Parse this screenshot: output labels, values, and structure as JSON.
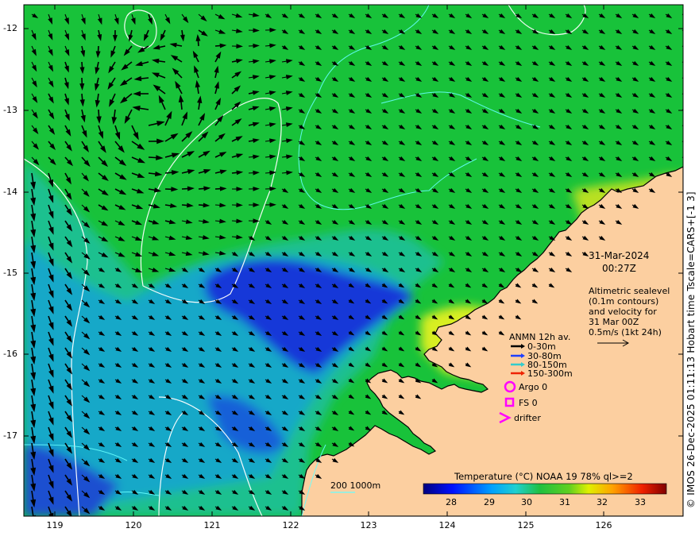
{
  "map": {
    "lat_ticks": [
      "-12",
      "-13",
      "-14",
      "-15",
      "-16",
      "-17"
    ],
    "lon_ticks": [
      "119",
      "120",
      "121",
      "122",
      "123",
      "124",
      "125",
      "126"
    ],
    "date": "31-Mar-2024",
    "time": "00:27Z",
    "side_label": "© IMOS 26-Dec-2025 01:11:13 Hobart time Tscale=CARS+[-1 3]",
    "altimetry_text": [
      "Altimetric sealevel",
      "(0.1m contours)",
      "and velocity for",
      "31 Mar 00Z",
      "0.5m/s (1kt 24h)"
    ],
    "legend": {
      "title": "ANMN 12h av.",
      "items": [
        {
          "label": "0-30m",
          "color": "#000000"
        },
        {
          "label": "30-80m",
          "color": "#1f3fff"
        },
        {
          "label": "80-150m",
          "color": "#33cccc"
        },
        {
          "label": "150-300m",
          "color": "#ee2200"
        }
      ],
      "argo": "Argo 0",
      "fs": "FS 0",
      "drifter": "drifter",
      "marker_color": "#ff00ff"
    },
    "depth_label": "200  1000m",
    "colorbar": {
      "title": "Temperature (°C) NOAA 19 78% ql>=2",
      "ticks": [
        "28",
        "29",
        "30",
        "31",
        "32",
        "33"
      ]
    },
    "colors": {
      "land": "#fccfa0",
      "coast": "#000000",
      "contour_white": "#ffffff",
      "contour_cyan": "#66ffff"
    }
  }
}
